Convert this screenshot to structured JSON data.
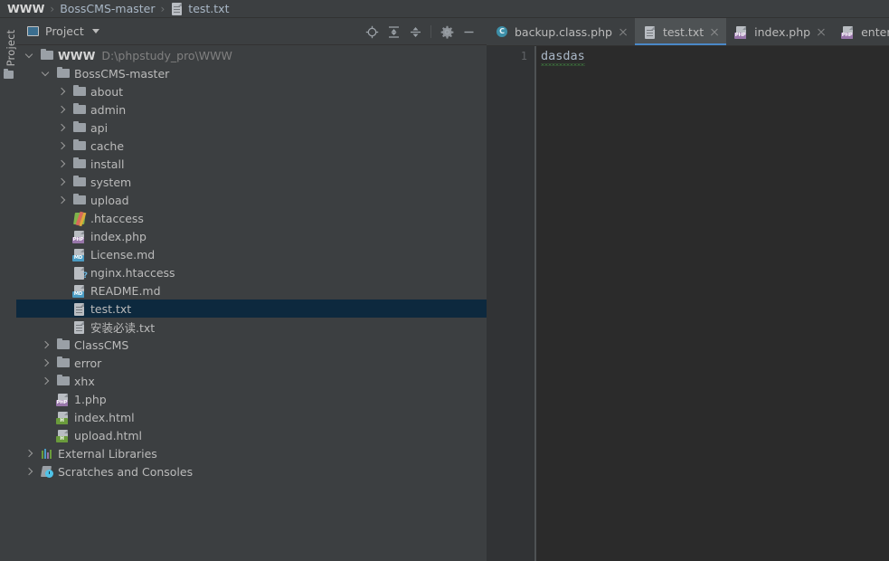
{
  "breadcrumb": {
    "items": [
      {
        "label": "WWW",
        "icon": "none",
        "bold": true
      },
      {
        "label": "BossCMS-master",
        "icon": "none",
        "bold": false
      },
      {
        "label": "test.txt",
        "icon": "txt-file-icon",
        "bold": false
      }
    ],
    "separator": "›"
  },
  "tool_strip": {
    "project_tab_label": "Project",
    "project_tab_icon": "folder-icon"
  },
  "panel": {
    "title": "Project",
    "title_icon": "project-view-icon",
    "dropdown_icon": "chevron-down-icon",
    "tools": [
      {
        "name": "locate-in-tree-icon",
        "glyph": "locate"
      },
      {
        "name": "expand-all-icon",
        "glyph": "expand"
      },
      {
        "name": "collapse-all-icon",
        "glyph": "collapse"
      },
      {
        "name": "settings-gear-icon",
        "glyph": "gear"
      },
      {
        "name": "hide-panel-icon",
        "glyph": "minus"
      }
    ]
  },
  "tree": {
    "rows": [
      {
        "label": "WWW",
        "sublabel": "D:\\phpstudy_pro\\WWW",
        "icon": "folder-icon",
        "depth": 0,
        "arrow": "down",
        "bold": true,
        "selected": false
      },
      {
        "label": "BossCMS-master",
        "sublabel": "",
        "icon": "folder-icon",
        "depth": 1,
        "arrow": "down",
        "bold": false,
        "selected": false
      },
      {
        "label": "about",
        "sublabel": "",
        "icon": "folder-icon",
        "depth": 2,
        "arrow": "right",
        "bold": false,
        "selected": false
      },
      {
        "label": "admin",
        "sublabel": "",
        "icon": "folder-icon",
        "depth": 2,
        "arrow": "right",
        "bold": false,
        "selected": false
      },
      {
        "label": "api",
        "sublabel": "",
        "icon": "folder-icon",
        "depth": 2,
        "arrow": "right",
        "bold": false,
        "selected": false
      },
      {
        "label": "cache",
        "sublabel": "",
        "icon": "folder-icon",
        "depth": 2,
        "arrow": "right",
        "bold": false,
        "selected": false
      },
      {
        "label": "install",
        "sublabel": "",
        "icon": "folder-icon",
        "depth": 2,
        "arrow": "right",
        "bold": false,
        "selected": false
      },
      {
        "label": "system",
        "sublabel": "",
        "icon": "folder-icon",
        "depth": 2,
        "arrow": "right",
        "bold": false,
        "selected": false
      },
      {
        "label": "upload",
        "sublabel": "",
        "icon": "folder-icon",
        "depth": 2,
        "arrow": "right",
        "bold": false,
        "selected": false
      },
      {
        "label": ".htaccess",
        "sublabel": "",
        "icon": "htaccess-file-icon",
        "depth": 2,
        "arrow": "none",
        "bold": false,
        "selected": false
      },
      {
        "label": "index.php",
        "sublabel": "",
        "icon": "php-file-icon",
        "depth": 2,
        "arrow": "none",
        "bold": false,
        "selected": false
      },
      {
        "label": "License.md",
        "sublabel": "",
        "icon": "markdown-file-icon",
        "depth": 2,
        "arrow": "none",
        "bold": false,
        "selected": false
      },
      {
        "label": "nginx.htaccess",
        "sublabel": "",
        "icon": "unknown-file-icon",
        "depth": 2,
        "arrow": "none",
        "bold": false,
        "selected": false
      },
      {
        "label": "README.md",
        "sublabel": "",
        "icon": "markdown-file-icon",
        "depth": 2,
        "arrow": "none",
        "bold": false,
        "selected": false
      },
      {
        "label": "test.txt",
        "sublabel": "",
        "icon": "txt-file-icon",
        "depth": 2,
        "arrow": "none",
        "bold": false,
        "selected": true
      },
      {
        "label": "安装必读.txt",
        "sublabel": "",
        "icon": "txt-file-icon",
        "depth": 2,
        "arrow": "none",
        "bold": false,
        "selected": false
      },
      {
        "label": "ClassCMS",
        "sublabel": "",
        "icon": "folder-icon",
        "depth": 1,
        "arrow": "right",
        "bold": false,
        "selected": false
      },
      {
        "label": "error",
        "sublabel": "",
        "icon": "folder-icon",
        "depth": 1,
        "arrow": "right",
        "bold": false,
        "selected": false
      },
      {
        "label": "xhx",
        "sublabel": "",
        "icon": "folder-icon",
        "depth": 1,
        "arrow": "right",
        "bold": false,
        "selected": false
      },
      {
        "label": "1.php",
        "sublabel": "",
        "icon": "php-file-icon",
        "depth": 1,
        "arrow": "none",
        "bold": false,
        "selected": false
      },
      {
        "label": "index.html",
        "sublabel": "",
        "icon": "html-file-icon",
        "depth": 1,
        "arrow": "none",
        "bold": false,
        "selected": false
      },
      {
        "label": "upload.html",
        "sublabel": "",
        "icon": "html-file-icon",
        "depth": 1,
        "arrow": "none",
        "bold": false,
        "selected": false
      },
      {
        "label": "External Libraries",
        "sublabel": "",
        "icon": "external-libraries-icon",
        "depth": 0,
        "arrow": "right",
        "bold": false,
        "selected": false
      },
      {
        "label": "Scratches and Consoles",
        "sublabel": "",
        "icon": "scratches-icon",
        "depth": 0,
        "arrow": "right",
        "bold": false,
        "selected": false
      }
    ]
  },
  "editor": {
    "tabs": [
      {
        "label": "backup.class.php",
        "icon": "class-file-icon",
        "badge": "C",
        "active": false
      },
      {
        "label": "test.txt",
        "icon": "txt-file-icon",
        "badge": "",
        "active": true
      },
      {
        "label": "index.php",
        "icon": "php-file-icon",
        "badge": "PHP",
        "active": false
      },
      {
        "label": "enter.php",
        "icon": "php-file-icon",
        "badge": "PHP",
        "active": false
      }
    ],
    "close_icon": "close-icon",
    "line_number": "1",
    "content": "dasdas"
  },
  "colors": {
    "accent_blue": "#4a88c7",
    "selection_blue": "#0d293e",
    "panel_bg": "#3c3f41",
    "editor_bg": "#2b2b2b",
    "gutter_bg": "#313335",
    "text": "#bbbbbb",
    "spellcheck_green": "#49a248"
  }
}
